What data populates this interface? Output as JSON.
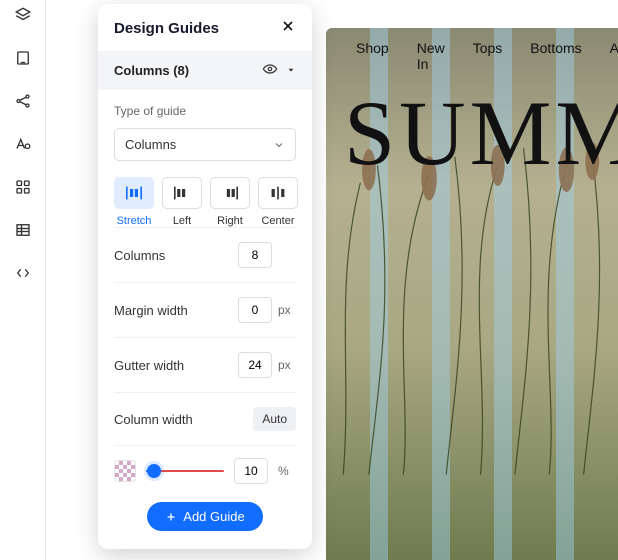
{
  "panel": {
    "title": "Design Guides",
    "section_title": "Columns (8)",
    "type_label": "Type of guide",
    "type_value": "Columns",
    "align": {
      "stretch": "Stretch",
      "left": "Left",
      "right": "Right",
      "center": "Center"
    },
    "fields": {
      "columns": {
        "label": "Columns",
        "value": "8"
      },
      "margin": {
        "label": "Margin width",
        "value": "0",
        "unit": "px"
      },
      "gutter": {
        "label": "Gutter width",
        "value": "24",
        "unit": "px"
      },
      "colw": {
        "label": "Column width",
        "value": "Auto"
      },
      "opacity": {
        "value": "10",
        "unit": "%"
      }
    },
    "add_button": "Add Guide"
  },
  "canvas": {
    "nav": [
      "Shop",
      "New In",
      "Tops",
      "Bottoms",
      "Accesso"
    ],
    "hero": "SUMM"
  }
}
